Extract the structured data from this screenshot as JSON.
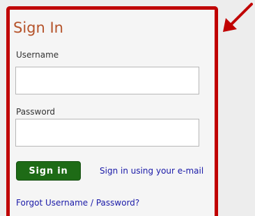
{
  "signin": {
    "title": "Sign In",
    "username_label": "Username",
    "username_value": "",
    "password_label": "Password",
    "password_value": "",
    "signin_button_label": "Sign in",
    "email_link_label": "Sign in using your e-mail",
    "forgot_link_label": "Forgot Username / Password?"
  },
  "colors": {
    "highlight_border": "#c00000",
    "arrow": "#c00000",
    "title": "#b5532a",
    "button_bg": "#1e6b16",
    "link": "#1a1aa8"
  },
  "icons": {
    "pointer": "arrow-pointer-icon"
  }
}
